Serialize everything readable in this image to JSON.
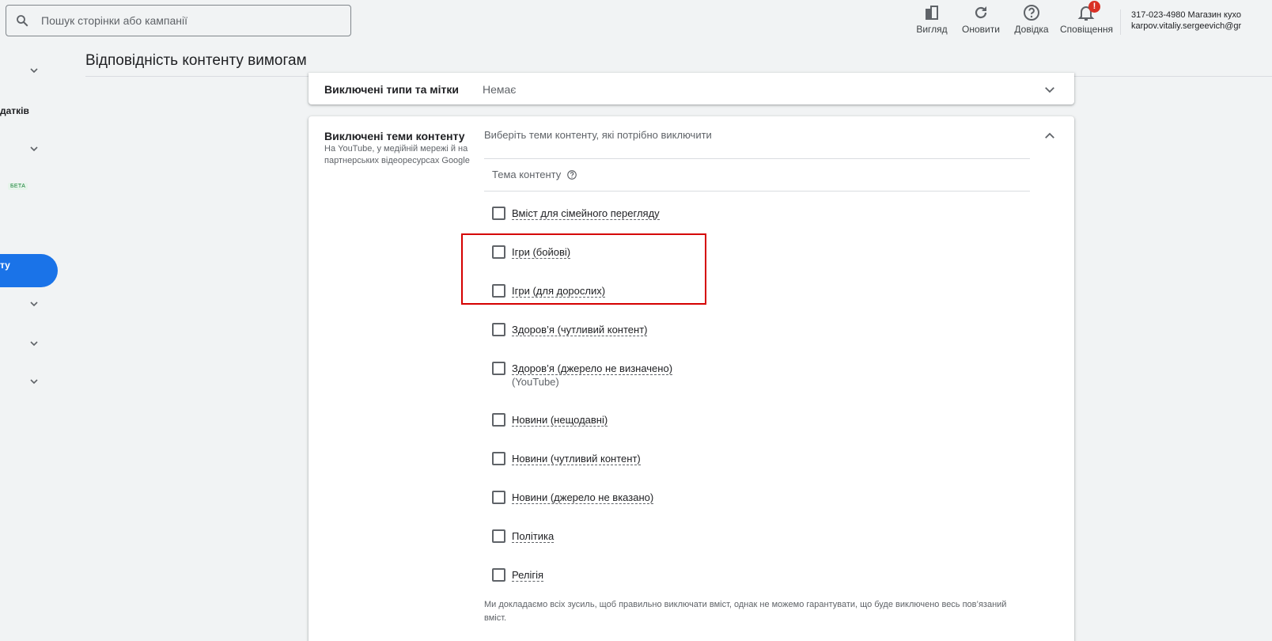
{
  "search": {
    "placeholder": "Пошук сторінки або кампанії"
  },
  "toolbar": [
    {
      "label": "Вигляд",
      "icon": "appearance-icon"
    },
    {
      "label": "Оновити",
      "icon": "refresh-icon"
    },
    {
      "label": "Довідка",
      "icon": "help-icon"
    },
    {
      "label": "Сповіщення",
      "icon": "bell-icon",
      "badge": "!"
    }
  ],
  "account": {
    "line1": "317-023-4980 Магазин кухо",
    "line2": "karpov.vitaliy.sergeevich@gr"
  },
  "sidebar": {
    "item_text": "датків",
    "beta": "БЕТА",
    "active_text": "ту"
  },
  "page": {
    "title": "Відповідність контенту вимогам"
  },
  "excluded_types": {
    "label": "Виключені типи та мітки",
    "value": "Немає"
  },
  "excluded_topics": {
    "title": "Виключені теми контенту",
    "subtitle": "На YouTube, у медійній мережі й на партнерських відеоресурсах Google",
    "hint": "Виберіть теми контенту, які потрібно виключити",
    "column_header": "Тема контенту",
    "options": [
      {
        "label": "Вміст для сімейного перегляду",
        "sub": "",
        "checked": false
      },
      {
        "label": "Ігри (бойові)",
        "sub": "",
        "checked": false
      },
      {
        "label": "Ігри (для дорослих)",
        "sub": "",
        "checked": false
      },
      {
        "label": "Здоров’я (чутливий контент)",
        "sub": "",
        "checked": false
      },
      {
        "label": "Здоров’я (джерело не визначено)",
        "sub": "(YouTube)",
        "checked": false
      },
      {
        "label": "Новини (нещодавні)",
        "sub": "",
        "checked": false
      },
      {
        "label": "Новини (чутливий контент)",
        "sub": "",
        "checked": false
      },
      {
        "label": "Новини (джерело не вказано)",
        "sub": "",
        "checked": false
      },
      {
        "label": "Політика",
        "sub": "",
        "checked": false
      },
      {
        "label": "Релігія",
        "sub": "",
        "checked": false
      }
    ],
    "footnote": "Ми докладаємо всіх зусиль, щоб правильно виключати вміст, однак не можемо гарантувати, що буде виключено весь пов’язаний вміст."
  },
  "colors": {
    "accent": "#1a73e8",
    "highlight_border": "#d50000",
    "badge": "#d93025"
  }
}
